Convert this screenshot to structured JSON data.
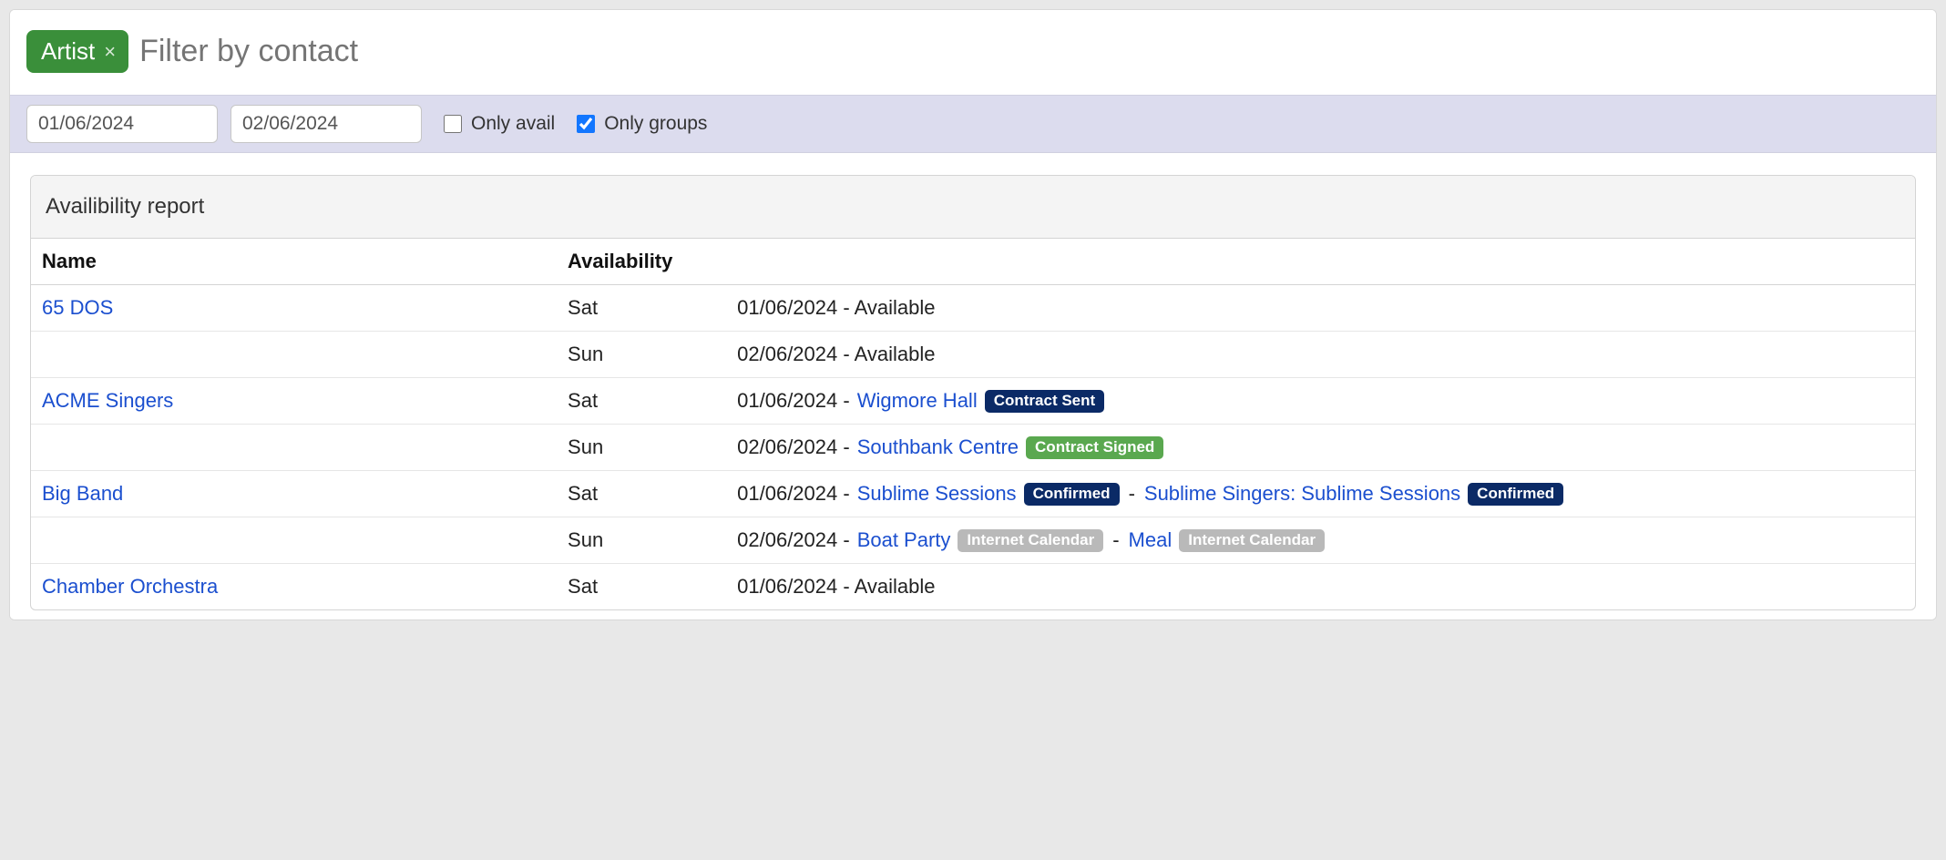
{
  "filter": {
    "tag_label": "Artist",
    "placeholder": "Filter by contact"
  },
  "dates": {
    "from": "01/06/2024",
    "to": "02/06/2024"
  },
  "options": {
    "only_avail_label": "Only avail",
    "only_avail_checked": false,
    "only_groups_label": "Only groups",
    "only_groups_checked": true
  },
  "report": {
    "title": "Availibility report",
    "columns": {
      "name": "Name",
      "availability": "Availability"
    },
    "rows": [
      {
        "name": "65 DOS",
        "day": "Sat",
        "date": "01/06/2024",
        "items": [
          {
            "type": "text",
            "value": "Available"
          }
        ]
      },
      {
        "name": "",
        "day": "Sun",
        "date": "02/06/2024",
        "items": [
          {
            "type": "text",
            "value": "Available"
          }
        ]
      },
      {
        "name": "ACME Singers",
        "day": "Sat",
        "date": "01/06/2024",
        "items": [
          {
            "type": "link",
            "value": "Wigmore Hall"
          },
          {
            "type": "badge",
            "value": "Contract Sent",
            "style": "navy"
          }
        ]
      },
      {
        "name": "",
        "day": "Sun",
        "date": "02/06/2024",
        "items": [
          {
            "type": "link",
            "value": "Southbank Centre"
          },
          {
            "type": "badge",
            "value": "Contract Signed",
            "style": "green"
          }
        ]
      },
      {
        "name": "Big Band",
        "day": "Sat",
        "date": "01/06/2024",
        "items": [
          {
            "type": "link",
            "value": "Sublime Sessions"
          },
          {
            "type": "badge",
            "value": "Confirmed",
            "style": "navy"
          },
          {
            "type": "sep",
            "value": "-"
          },
          {
            "type": "link",
            "value": "Sublime Singers: Sublime Sessions"
          },
          {
            "type": "badge",
            "value": "Confirmed",
            "style": "navy"
          }
        ]
      },
      {
        "name": "",
        "day": "Sun",
        "date": "02/06/2024",
        "items": [
          {
            "type": "link",
            "value": "Boat Party"
          },
          {
            "type": "badge",
            "value": "Internet Calendar",
            "style": "grey"
          },
          {
            "type": "sep",
            "value": "-"
          },
          {
            "type": "link",
            "value": "Meal"
          },
          {
            "type": "badge",
            "value": "Internet Calendar",
            "style": "grey"
          }
        ]
      },
      {
        "name": "Chamber Orchestra",
        "day": "Sat",
        "date": "01/06/2024",
        "items": [
          {
            "type": "text",
            "value": "Available"
          }
        ]
      }
    ]
  }
}
